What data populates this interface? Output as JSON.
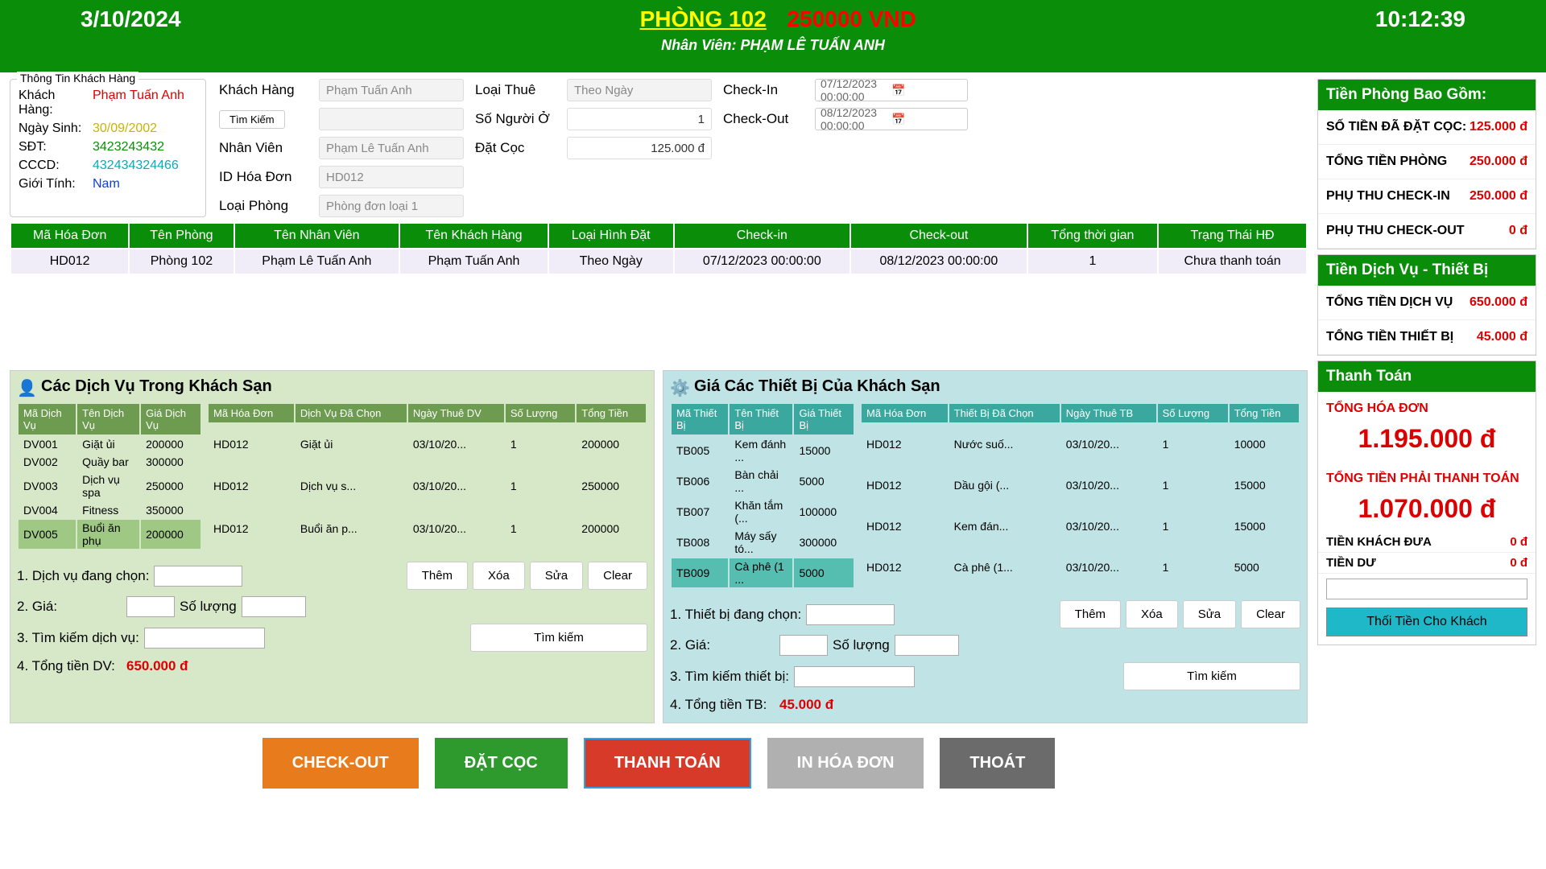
{
  "header": {
    "date": "3/10/2024",
    "room": "PHÒNG 102",
    "price": "250000 VND",
    "time": "10:12:39",
    "staff_line": "Nhân Viên: PHẠM LÊ TUẤN ANH"
  },
  "customer_box": {
    "title": "Thông Tin Khách Hàng",
    "name_label": "Khách Hàng:",
    "name": "Phạm Tuấn Anh",
    "dob_label": "Ngày Sinh:",
    "dob": "30/09/2002",
    "phone_label": "SĐT:",
    "phone": "3423243432",
    "id_label": "CCCD:",
    "id": "432434324466",
    "gender_label": "Giới Tính:",
    "gender": "Nam"
  },
  "form": {
    "customer_label": "Khách Hàng",
    "customer": "Phạm Tuấn Anh",
    "find": "Tìm Kiếm",
    "staff_label": "Nhân Viên",
    "staff": "Phạm Lê Tuấn Anh",
    "invoice_label": "ID Hóa Đơn",
    "invoice": "HD012",
    "roomtype_label": "Loại Phòng",
    "roomtype": "Phòng đơn loại 1",
    "renttype_label": "Loại Thuê",
    "renttype": "Theo Ngày",
    "people_label": "Số Người Ở",
    "people": "1",
    "deposit_label": "Đặt Cọc",
    "deposit": "125.000 đ",
    "checkin_label": "Check-In",
    "checkin": "07/12/2023 00:00:00",
    "checkout_label": "Check-Out",
    "checkout": "08/12/2023 00:00:00"
  },
  "booking_table": {
    "headers": [
      "Mã Hóa Đơn",
      "Tên Phòng",
      "Tên Nhân Viên",
      "Tên Khách Hàng",
      "Loại Hình Đặt",
      "Check-in",
      "Check-out",
      "Tổng thời gian",
      "Trạng Thái HĐ"
    ],
    "row": [
      "HD012",
      "Phòng 102",
      "Phạm Lê Tuấn Anh",
      "Phạm Tuấn Anh",
      "Theo Ngày",
      "07/12/2023 00:00:00",
      "08/12/2023 00:00:00",
      "1",
      "Chưa thanh toán"
    ]
  },
  "services": {
    "title": "Các Dịch Vụ Trong Khách Sạn",
    "left_headers": [
      "Mã Dịch Vụ",
      "Tên Dịch Vụ",
      "Giá Dịch Vụ"
    ],
    "left_rows": [
      [
        "DV001",
        "Giặt ủi",
        "200000"
      ],
      [
        "DV002",
        "Quầy bar",
        "300000"
      ],
      [
        "DV003",
        "Dịch vụ spa",
        "250000"
      ],
      [
        "DV004",
        "Fitness",
        "350000"
      ],
      [
        "DV005",
        "Buổi ăn phụ",
        "200000"
      ]
    ],
    "right_headers": [
      "Mã Hóa Đơn",
      "Dịch Vụ Đã Chọn",
      "Ngày Thuê DV",
      "Số Lượng",
      "Tổng Tiền"
    ],
    "right_rows": [
      [
        "HD012",
        "Giặt ủi",
        "03/10/20...",
        "1",
        "200000"
      ],
      [
        "HD012",
        "Dịch vụ s...",
        "03/10/20...",
        "1",
        "250000"
      ],
      [
        "HD012",
        "Buổi ăn p...",
        "03/10/20...",
        "1",
        "200000"
      ]
    ],
    "f1": "1. Dịch vụ đang chọn:",
    "f2": "2. Giá:",
    "qty": "Số lượng",
    "f3": "3. Tìm kiếm dịch vụ:",
    "f4": "4. Tổng tiền DV:",
    "total": "650.000 đ",
    "btns": [
      "Thêm",
      "Xóa",
      "Sửa",
      "Clear"
    ],
    "search": "Tìm kiếm"
  },
  "equipment": {
    "title": "Giá Các Thiết Bị Của Khách Sạn",
    "left_headers": [
      "Mã Thiết Bị",
      "Tên Thiết Bị",
      "Giá Thiết Bị"
    ],
    "left_rows": [
      [
        "TB005",
        "Kem đánh ...",
        "15000"
      ],
      [
        "TB006",
        "Bàn chải ...",
        "5000"
      ],
      [
        "TB007",
        "Khăn tắm (...",
        "100000"
      ],
      [
        "TB008",
        "Máy sấy tó...",
        "300000"
      ],
      [
        "TB009",
        "Cà phê (1 ...",
        "5000"
      ]
    ],
    "right_headers": [
      "Mã Hóa Đơn",
      "Thiết Bị Đã Chọn",
      "Ngày Thuê TB",
      "Số Lượng",
      "Tổng Tiền"
    ],
    "right_rows": [
      [
        "HD012",
        "Nước suố...",
        "03/10/20...",
        "1",
        "10000"
      ],
      [
        "HD012",
        "Dầu gội (...",
        "03/10/20...",
        "1",
        "15000"
      ],
      [
        "HD012",
        "Kem đán...",
        "03/10/20...",
        "1",
        "15000"
      ],
      [
        "HD012",
        "Cà phê (1...",
        "03/10/20...",
        "1",
        "5000"
      ]
    ],
    "f1": "1. Thiết bị đang chọn:",
    "f2": "2. Giá:",
    "qty": "Số lượng",
    "f3": "3. Tìm kiếm thiết bị:",
    "f4": "4. Tổng tiền TB:",
    "total": "45.000 đ",
    "btns": [
      "Thêm",
      "Xóa",
      "Sửa",
      "Clear"
    ],
    "search": "Tìm kiếm"
  },
  "bottom_btns": [
    "CHECK-OUT",
    "ĐẶT CỌC",
    "THANH TOÁN",
    "IN HÓA ĐƠN",
    "THOÁT"
  ],
  "summary": {
    "s1_title": "Tiền Phòng Bao Gồm:",
    "s1": [
      [
        "SỐ TIỀN ĐÃ ĐẶT CỌC:",
        "125.000 đ"
      ],
      [
        "TỔNG TIỀN PHÒNG",
        "250.000 đ"
      ],
      [
        "PHỤ THU CHECK-IN",
        "250.000 đ"
      ],
      [
        "PHỤ THU CHECK-OUT",
        "0 đ"
      ]
    ],
    "s2_title": "Tiền Dịch Vụ - Thiết Bị",
    "s2": [
      [
        "TỔNG TIỀN DỊCH VỤ",
        "650.000 đ"
      ],
      [
        "TỔNG TIỀN THIẾT BỊ",
        "45.000 đ"
      ]
    ],
    "s3_title": "Thanh Toán",
    "total_lbl": "TỔNG HÓA ĐƠN",
    "total_val": "1.195.000 đ",
    "pay_lbl": "TỔNG TIỀN PHẢI THANH TOÁN",
    "pay_val": "1.070.000 đ",
    "given": "TIỀN KHÁCH ĐƯA",
    "given_v": "0 đ",
    "change": "TIỀN DƯ",
    "change_v": "0 đ",
    "refund_btn": "Thối Tiền Cho Khách"
  }
}
